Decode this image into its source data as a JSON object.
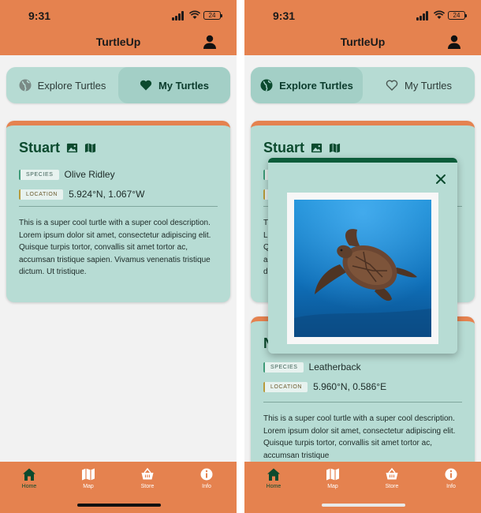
{
  "status": {
    "time": "9:31",
    "battery": "24"
  },
  "header": {
    "title": "TurtleUp"
  },
  "tabs": {
    "explore": "Explore Turtles",
    "mine": "My Turtles"
  },
  "cards": [
    {
      "name": "Stuart",
      "species_label": "SPECIES",
      "species": "Olive Ridley",
      "location_label": "LOCATION",
      "location": "5.924°N, 1.067°W",
      "description": "This is a super cool turtle with a super cool description. Lorem ipsum dolor sit amet, consectetur adipiscing elit. Quisque turpis tortor, convallis sit amet tortor ac, accumsan tristique sapien. Vivamus venenatis tristique dictum. Ut tristique."
    },
    {
      "name": "N",
      "species_label": "SPECIES",
      "species": "Leatherback",
      "location_label": "LOCATION",
      "location": "5.960°N, 0.586°E",
      "description": "This is a super cool turtle with a super cool description. Lorem ipsum dolor sit amet, consectetur adipiscing elit. Quisque turpis tortor, convallis sit amet tortor ac, accumsan tristique"
    }
  ],
  "nav": {
    "home": "Home",
    "map": "Map",
    "store": "Store",
    "info": "Info"
  },
  "colors": {
    "accent": "#e5824f",
    "card": "#b7dcd4",
    "dark_green": "#0b4a2e"
  },
  "icons": [
    "person-icon",
    "globe-icon",
    "heart-icon",
    "image-icon",
    "map-icon",
    "close-icon",
    "home-icon",
    "basket-icon",
    "info-icon"
  ]
}
